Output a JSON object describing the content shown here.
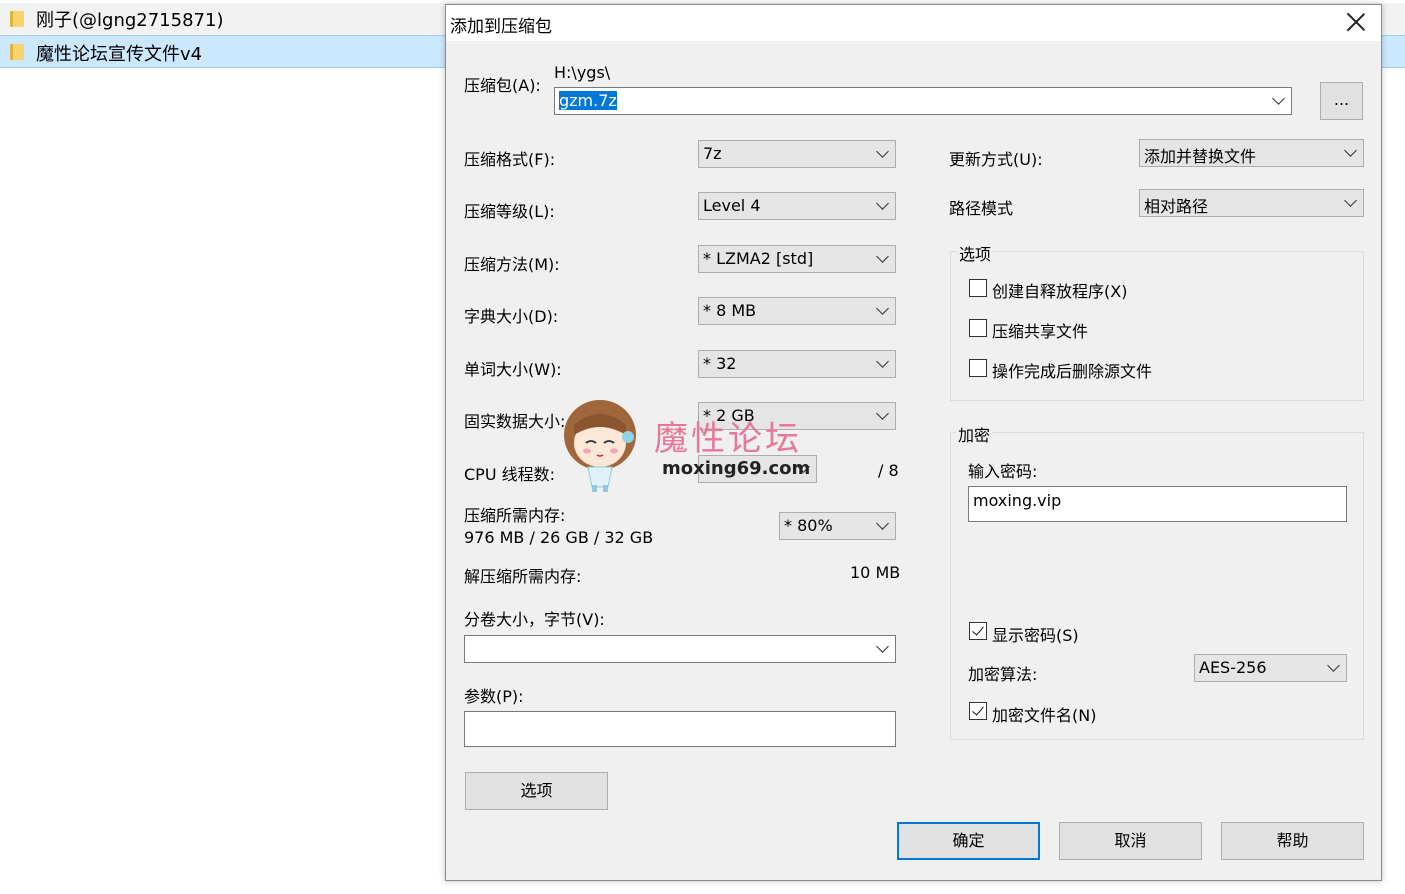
{
  "explorer": {
    "rows": [
      {
        "name": "刚子(@lgng2715871)"
      },
      {
        "name": "魔性论坛宣传文件v4"
      }
    ]
  },
  "dialog": {
    "title": "添加到压缩包",
    "archive_label": "压缩包(A):",
    "archive_path": "H:\\ygs\\",
    "archive_name": "gzm.7z",
    "browse_label": "...",
    "format_label": "压缩格式(F):",
    "format_value": "7z",
    "level_label": "压缩等级(L):",
    "level_value": "Level 4",
    "method_label": "压缩方法(M):",
    "method_value": "*  LZMA2 [std]",
    "dict_label": "字典大小(D):",
    "dict_value": "*  8 MB",
    "word_label": "单词大小(W):",
    "word_value": "*  32",
    "solid_label": "固实数据大小:",
    "solid_value": "*  2 GB",
    "cpu_label": "CPU 线程数:",
    "cpu_value": "",
    "cpu_total": "/ 8",
    "mem_label": "压缩所需内存:",
    "mem_value": "976 MB / 26 GB / 32 GB",
    "mem_percent": "* 80%",
    "decomp_label": "解压缩所需内存:",
    "decomp_value": "10 MB",
    "volume_label": "分卷大小，字节(V):",
    "volume_value": "",
    "params_label": "参数(P):",
    "params_value": "",
    "options_button": "选项",
    "update_label": "更新方式(U):",
    "update_value": "添加并替换文件",
    "path_label": "路径模式",
    "path_value": "相对路径",
    "options_group": "选项",
    "opt_sfx": "创建自释放程序(X)",
    "opt_shared": "压缩共享文件",
    "opt_delete": "操作完成后删除源文件",
    "encrypt_group": "加密",
    "password_label": "输入密码:",
    "password_value": "moxing.vip",
    "show_password": "显示密码(S)",
    "algo_label": "加密算法:",
    "algo_value": "AES-256",
    "encrypt_names": "加密文件名(N)",
    "ok": "确定",
    "cancel": "取消",
    "help": "帮助"
  },
  "watermark": {
    "title": "魔性论坛",
    "url": "moxing69.com"
  }
}
